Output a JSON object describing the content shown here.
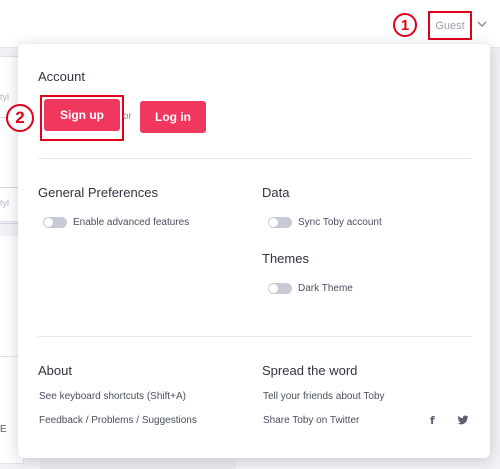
{
  "background": {
    "hint_1": "tyl",
    "hint_2": "tyl",
    "hint_3": "E"
  },
  "header": {
    "guest_label": "Guest",
    "marker_1": "1",
    "chevron_icon": "chevron-down-icon"
  },
  "account": {
    "title": "Account",
    "signup_label": "Sign up",
    "or_label": "or",
    "login_label": "Log in",
    "marker_2": "2"
  },
  "general": {
    "title": "General Preferences",
    "advanced_label": "Enable advanced features"
  },
  "data_section": {
    "title": "Data",
    "sync_label": "Sync Toby account"
  },
  "themes": {
    "title": "Themes",
    "dark_label": "Dark Theme"
  },
  "about": {
    "title": "About",
    "shortcuts_label": "See keyboard shortcuts (Shift+A)",
    "feedback_label": "Feedback / Problems / Suggestions"
  },
  "spread": {
    "title": "Spread the word",
    "friends_label": "Tell your friends about Toby",
    "twitter_label": "Share Toby on Twitter",
    "facebook_icon": "facebook-icon",
    "twitter_icon": "twitter-icon"
  },
  "colors": {
    "accent": "#f0375e",
    "highlight_frame": "#e0001a"
  }
}
